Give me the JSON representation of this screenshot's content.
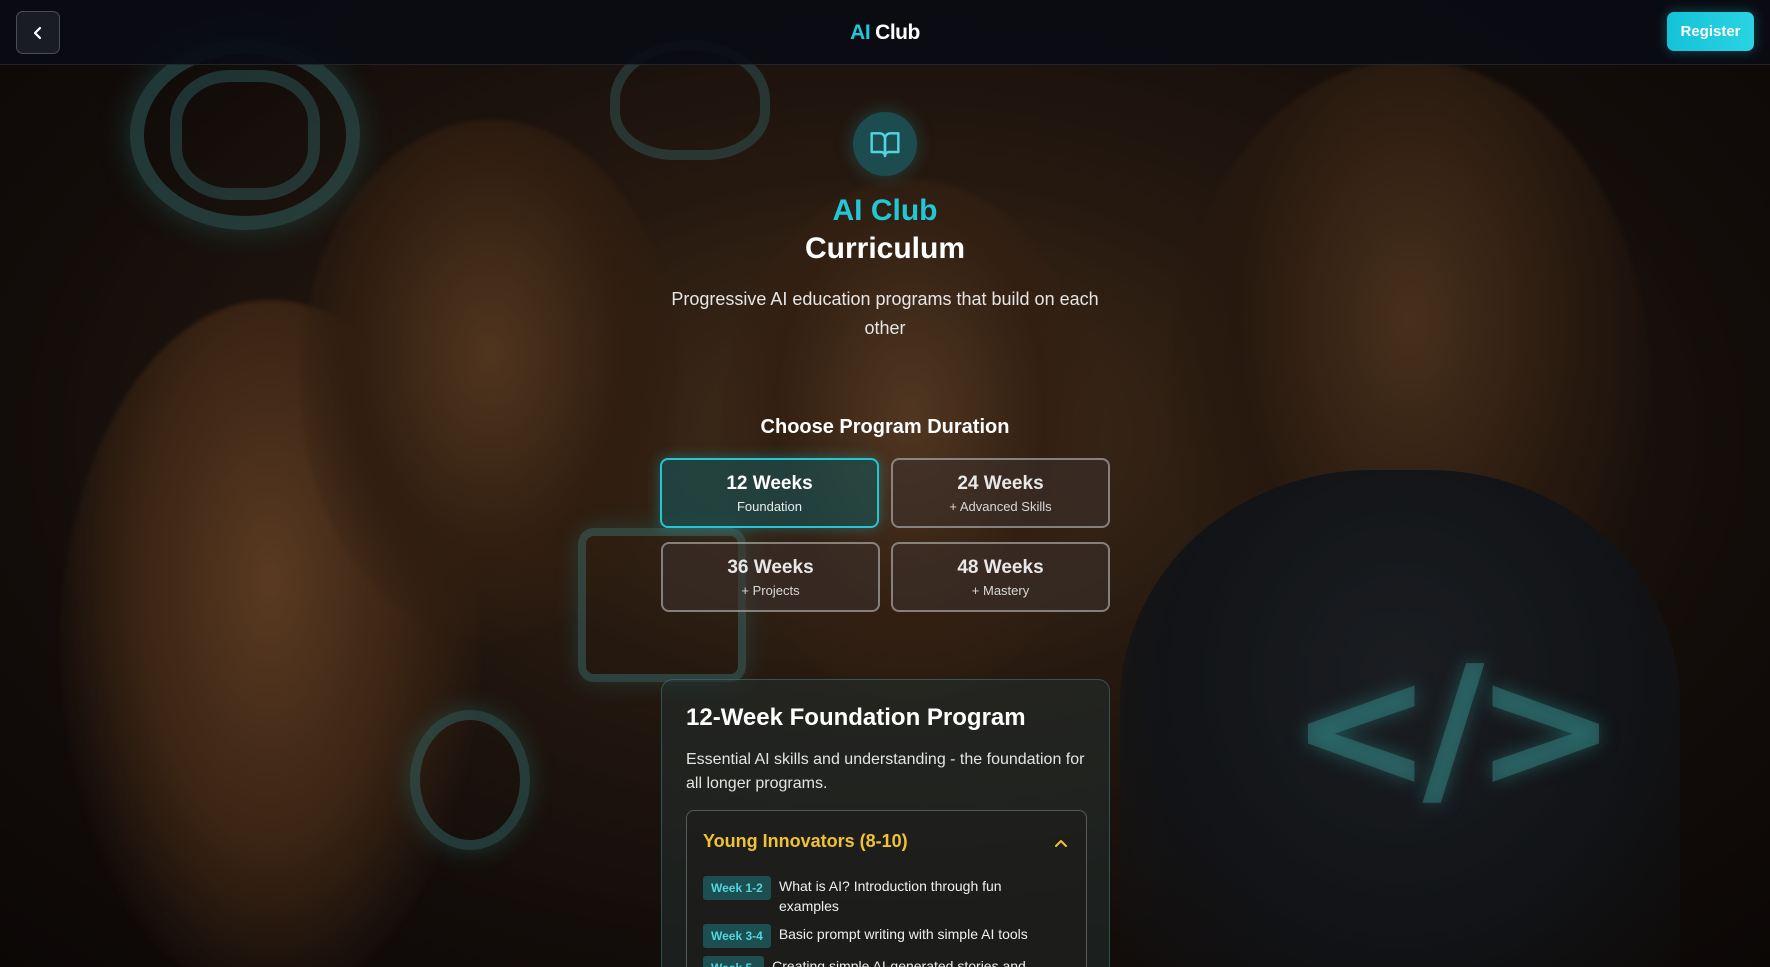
{
  "header": {
    "brand_ai": "AI",
    "brand_club": "Club",
    "register_label": "Register"
  },
  "hero": {
    "title_accent": "AI Club",
    "title_main": "Curriculum",
    "subtitle": "Progressive AI education programs that build on each other"
  },
  "duration": {
    "heading": "Choose Program Duration",
    "options": [
      {
        "weeks": "12 Weeks",
        "sub": "Foundation",
        "selected": true
      },
      {
        "weeks": "24 Weeks",
        "sub": "+ Advanced Skills",
        "selected": false
      },
      {
        "weeks": "36 Weeks",
        "sub": "+ Projects",
        "selected": false
      },
      {
        "weeks": "48 Weeks",
        "sub": "+ Mastery",
        "selected": false
      }
    ]
  },
  "program": {
    "title": "12-Week Foundation Program",
    "description": "Essential AI skills and understanding - the foundation for all longer programs.",
    "group": {
      "title": "Young Innovators (8-10)",
      "weeks": [
        {
          "tag": "Week 1-2",
          "text": "What is AI? Introduction through fun examples"
        },
        {
          "tag": "Week 3-4",
          "text": "Basic prompt writing with simple AI tools"
        },
        {
          "tag": "Week 5-",
          "text": "Creating simple AI-generated stories and"
        }
      ]
    }
  },
  "colors": {
    "accent": "#22c7d6",
    "group_title": "#f1c232",
    "header_bg": "#0a0c14"
  },
  "icons": [
    "chevron-left-icon",
    "book-open-icon",
    "chevron-up-icon"
  ]
}
